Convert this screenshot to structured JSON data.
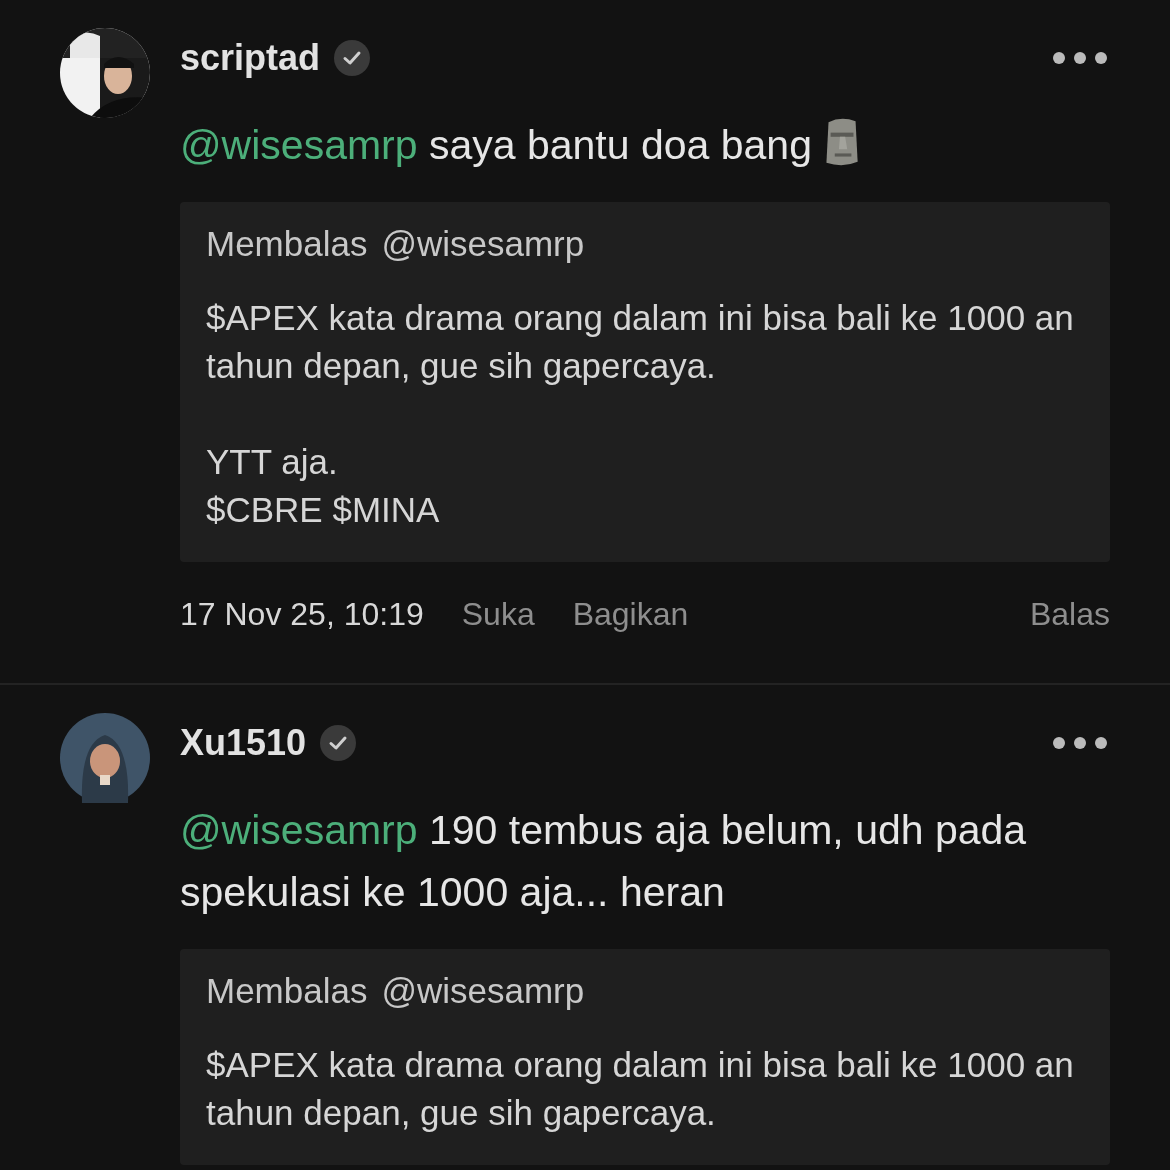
{
  "posts": [
    {
      "username": "scriptad",
      "verified": true,
      "mention": "@wisesamrp",
      "text": "saya bantu doa bang",
      "emoji": {
        "kind": "moai"
      },
      "quote": {
        "label": "Membalas",
        "handle": "@wisesamrp",
        "paragraphs": [
          [
            "$APEX kata drama orang dalam ini bisa bali ke 1000 an tahun depan, gue sih gapercaya."
          ],
          [
            "YTT aja.",
            "$CBRE $MINA"
          ]
        ]
      },
      "meta": {
        "timestamp": "17 Nov 25, 10:19",
        "actions": [
          "Suka",
          "Bagikan"
        ],
        "reply": "Balas"
      }
    },
    {
      "avatar": {
        "kind": "cartoon"
      },
      "username": "Xu1510",
      "verified": true,
      "mention": "@wisesamrp",
      "text": "190 tembus aja belum, udh pada spekulasi ke 1000 aja... heran",
      "quote": {
        "label": "Membalas",
        "handle": "@wisesamrp",
        "paragraphs": [
          [
            "$APEX kata drama orang dalam ini bisa bali ke 1000 an tahun depan, gue sih gapercaya."
          ]
        ]
      }
    }
  ]
}
